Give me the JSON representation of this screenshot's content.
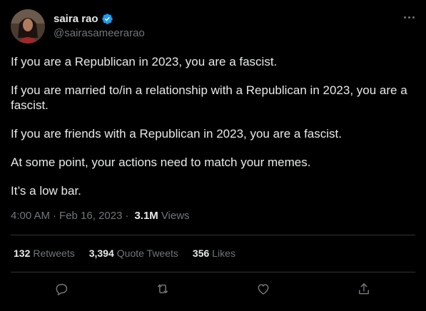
{
  "author": {
    "name": "saira rao",
    "handle": "@sairasameerarao",
    "verified_icon": "verified-badge-icon",
    "verified_color": "#1d9bf0"
  },
  "tweet": {
    "paragraphs": [
      "If you are a Republican in 2023, you are a fascist.",
      "If you are married to/in a relationship with a Republican in 2023, you are a fascist.",
      "If you are friends with a Republican in 2023, you are a fascist.",
      "At some point, your actions need to match your memes.",
      "It’s a low bar."
    ],
    "time": "4:00 AM",
    "separator": "·",
    "date": "Feb 16, 2023",
    "views_count": "3.1M",
    "views_label": "Views"
  },
  "stats": {
    "retweets_count": "132",
    "retweets_label": "Retweets",
    "quote_count": "3,394",
    "quote_label": "Quote Tweets",
    "likes_count": "356",
    "likes_label": "Likes"
  },
  "actions": [
    "reply-icon",
    "retweet-icon",
    "like-icon",
    "share-icon"
  ],
  "colors": {
    "background": "#000000",
    "text": "#e7e9ea",
    "secondary": "#71767b",
    "divider": "#2f3336"
  }
}
